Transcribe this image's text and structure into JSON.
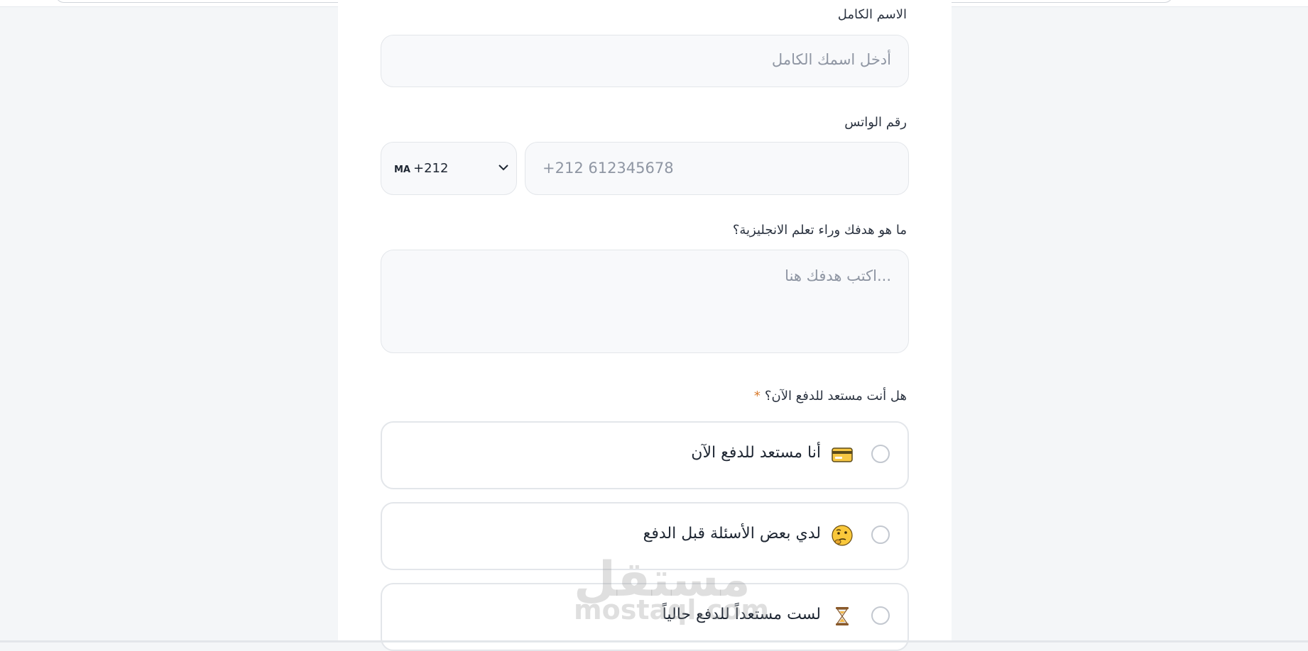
{
  "form": {
    "full_name": {
      "label": "الاسم الكامل",
      "placeholder": "أدخل اسمك الكامل"
    },
    "whatsapp": {
      "label": "رقم الواتس",
      "country_code": "+212",
      "country_flag": "MA",
      "placeholder": "+212 612345678"
    },
    "goal": {
      "label": "ما هو هدفك وراء تعلم الانجليزية؟",
      "placeholder": "اكتب هدفك هنا..."
    },
    "payment": {
      "label": "هل أنت مستعد للدفع الآن؟",
      "required_mark": "*",
      "options": [
        {
          "label": "أنا مستعد للدفع الآن",
          "icon": "credit-card-icon"
        },
        {
          "label": "لدي بعض الأسئلة قبل الدفع",
          "icon": "thinking-face-icon"
        },
        {
          "label": "لست مستعداً للدفع حالياً",
          "icon": "hourglass-icon"
        }
      ]
    }
  },
  "watermark": {
    "arabic": "مستقل",
    "latin": "mostaql.com"
  },
  "colors": {
    "required": "#d97a2b",
    "field_bg": "#f8f9fb",
    "border": "#e3e6ea",
    "page_bg": "#f4f6f8"
  }
}
